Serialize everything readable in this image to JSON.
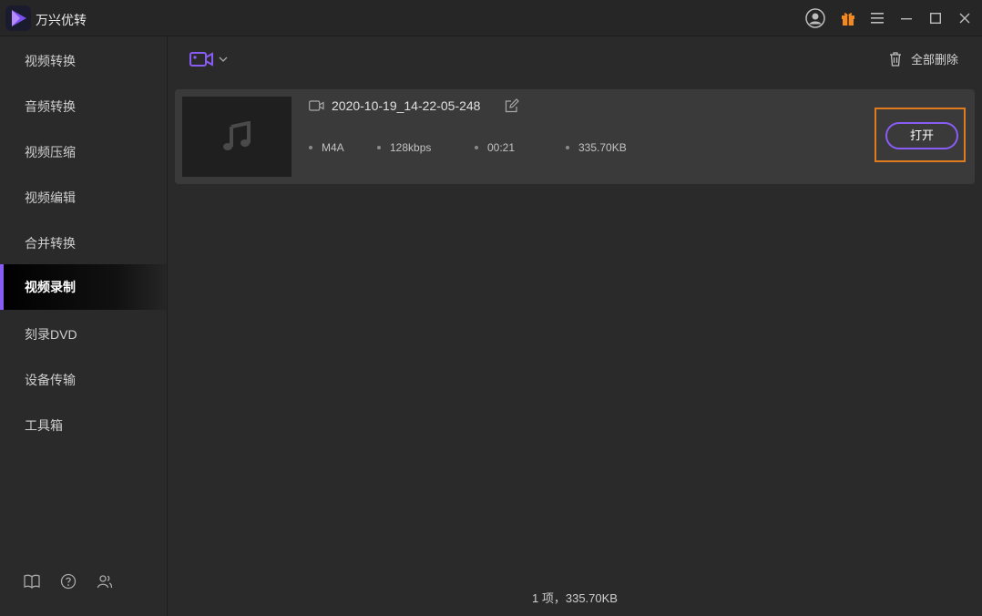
{
  "app": {
    "title": "万兴优转"
  },
  "titlebar": {
    "icons": [
      "account-icon",
      "gift-icon",
      "menu-icon",
      "minimize-icon",
      "maximize-icon",
      "close-icon"
    ]
  },
  "sidebar": {
    "items": [
      {
        "label": "视频转换",
        "active": false
      },
      {
        "label": "音频转换",
        "active": false
      },
      {
        "label": "视频压缩",
        "active": false
      },
      {
        "label": "视频编辑",
        "active": false
      },
      {
        "label": "合并转换",
        "active": false
      },
      {
        "label": "视频录制",
        "active": true
      },
      {
        "label": "刻录DVD",
        "active": false
      },
      {
        "label": "设备传输",
        "active": false
      },
      {
        "label": "工具箱",
        "active": false
      }
    ],
    "footer_icons": [
      "book-icon",
      "help-icon",
      "user-group-icon"
    ]
  },
  "toolbar": {
    "record_icon": "video-camera-icon",
    "delete_all_label": "全部删除"
  },
  "file": {
    "name": "2020-10-19_14-22-05-248",
    "format": "M4A",
    "bitrate": "128kbps",
    "duration": "00:21",
    "size": "335.70KB",
    "open_label": "打开"
  },
  "status": {
    "summary": "1 项，335.70KB"
  },
  "colors": {
    "accent": "#8a5cf6",
    "highlight": "#e07b1f",
    "gift": "#f08a24"
  }
}
